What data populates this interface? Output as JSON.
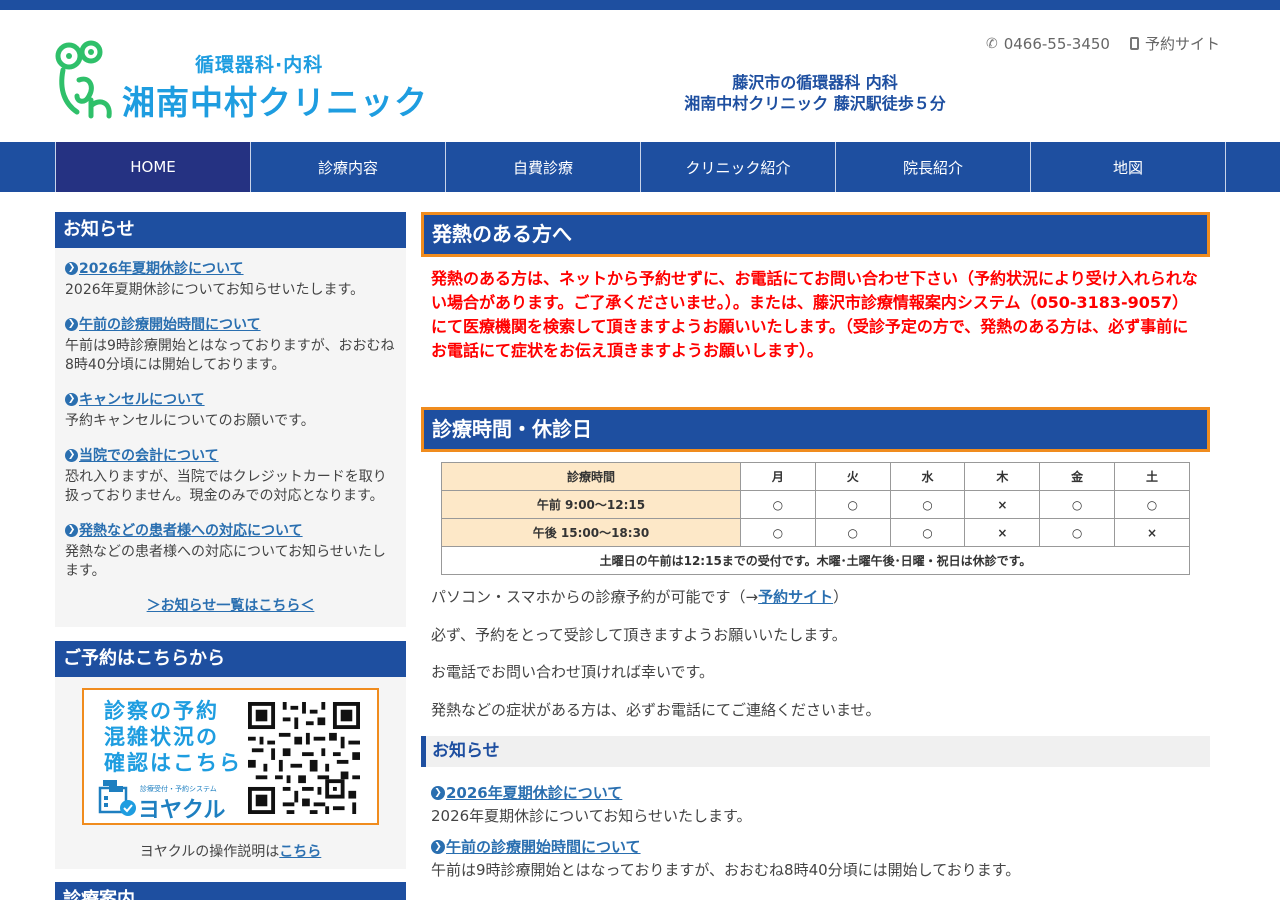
{
  "header": {
    "logo_sub": "循環器科·内科",
    "logo_main": "湘南中村クリニック",
    "phone": "0466-55-3450",
    "reserve_site": "予約サイト",
    "tagline_line1": "藤沢市の循環器科 内科",
    "tagline_line2": "湘南中村クリニック 藤沢駅徒歩５分"
  },
  "nav": {
    "items": [
      "HOME",
      "診療内容",
      "自費診療",
      "クリニック紹介",
      "院長紹介",
      "地図"
    ],
    "active": "HOME"
  },
  "sidebar": {
    "news_title": "お知らせ",
    "news": [
      {
        "title": "2026年夏期休診について",
        "desc": "2026年夏期休診についてお知らせいたします。"
      },
      {
        "title": "午前の診療開始時間について",
        "desc": "午前は9時診療開始とはなっておりますが、おおむね8時40分頃には開始しております。"
      },
      {
        "title": "キャンセルについて",
        "desc": "予約キャンセルについてのお願いです。"
      },
      {
        "title": "当院での会計について",
        "desc": "恐れ入りますが、当院ではクレジットカードを取り扱っておりません。現金のみでの対応となります。"
      },
      {
        "title": "発熱などの患者様への対応について",
        "desc": "発熱などの患者様への対応についてお知らせいたします。"
      }
    ],
    "news_more": "＞お知らせ一覧はこちら＜",
    "reserve_title": "ご予約はこちらから",
    "banner_line1": "診察の予約",
    "banner_line2": "混雑状況の",
    "banner_line3": "確認はこちら",
    "banner_brand_sub": "診療受付・予約システム",
    "banner_brand": "ヨヤクル",
    "reserve_note": "ヨヤクルの操作説明は",
    "reserve_note_link": "こちら",
    "guide_title": "診療案内"
  },
  "main": {
    "fever_title": "発熱のある方へ",
    "fever_text": "発熱のある方は、ネットから予約せずに、お電話にてお問い合わせ下さい（予約状況により受け入れられない場合があります。ご了承くださいませ。）。または、藤沢市診療情報案内システム（050-3183-9057）にて医療機関を検索して頂きますようお願いいたします。（受診予定の方で、発熱のある方は、必ず事前にお電話にて症状をお伝え頂きますようお願いします）。",
    "hours_title": "診療時間・休診日",
    "hours_table": {
      "header": [
        "診療時間",
        "月",
        "火",
        "水",
        "木",
        "金",
        "土"
      ],
      "rows": [
        [
          "午前 9:00～12:15",
          "○",
          "○",
          "○",
          "×",
          "○",
          "○"
        ],
        [
          "午後 15:00～18:30",
          "○",
          "○",
          "○",
          "×",
          "○",
          "×"
        ]
      ],
      "note": "土曜日の午前は12:15までの受付です。木曜･土曜午後･日曜・祝日は休診です。"
    },
    "para1_pre": "パソコン・スマホからの診療予約が可能です（→",
    "para1_link": "予約サイト",
    "para1_post": "）",
    "para2": "必ず、予約をとって受診して頂きますようお願いいたします。",
    "para3": "お電話でお問い合わせ頂ければ幸いです。",
    "para4": "発熱などの症状がある方は、必ずお電話にてご連絡くださいませ。",
    "news_title": "お知らせ",
    "news": [
      {
        "title": "2026年夏期休診について",
        "desc": "2026年夏期休診についてお知らせいたします。"
      },
      {
        "title": "午前の診療開始時間について",
        "desc": "午前は9時診療開始とはなっておりますが、おおむね8時40分頃には開始しております。"
      }
    ]
  },
  "colors": {
    "primary": "#1e4fa0",
    "accent_orange": "#f08c1e",
    "logo_blue": "#1e9de0",
    "logo_green": "#2fc06a",
    "alert_red": "#ff0000",
    "link": "#2a6fb0"
  }
}
